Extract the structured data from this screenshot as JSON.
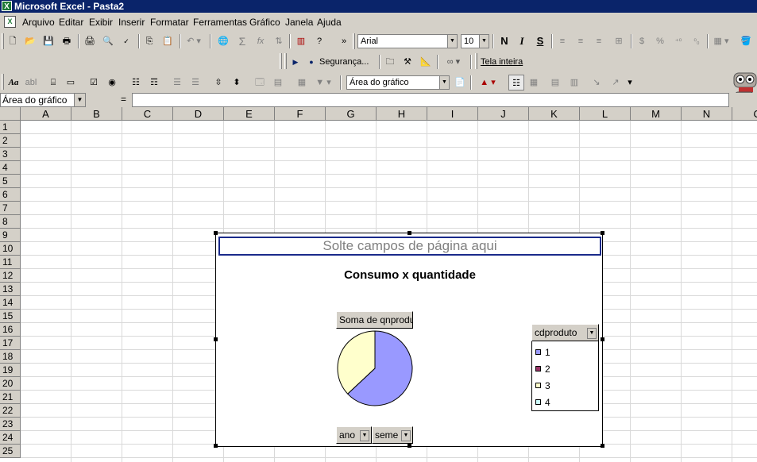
{
  "window": {
    "title": "Microsoft Excel - Pasta2"
  },
  "menu": [
    "Arquivo",
    "Editar",
    "Exibir",
    "Inserir",
    "Formatar",
    "Ferramentas",
    "Gráfico",
    "Janela",
    "Ajuda"
  ],
  "toolbar_standard": {
    "font_name": "Arial",
    "font_size": "10",
    "bold_label": "N",
    "italic_label": "I",
    "underline_label": "S"
  },
  "toolbar_security": {
    "security_label": "Segurança...",
    "fullscreen_label": "Tela inteira"
  },
  "toolbar_chart": {
    "chart_area_label": "Área do gráfico",
    "font_label": "Aa",
    "abl_label": "abl"
  },
  "formula_bar": {
    "name_box": "Área do gráfico",
    "equals": "="
  },
  "columns": [
    "A",
    "B",
    "C",
    "D",
    "E",
    "F",
    "G",
    "H",
    "I",
    "J",
    "K",
    "L",
    "M",
    "N",
    "O"
  ],
  "rows": [
    "1",
    "2",
    "3",
    "4",
    "5",
    "6",
    "7",
    "8",
    "9",
    "10",
    "11",
    "12",
    "13",
    "14",
    "15",
    "16",
    "17",
    "18",
    "19",
    "20",
    "21",
    "22",
    "23",
    "24",
    "25"
  ],
  "chart": {
    "drop_zone_text": "Solte campos de página aqui",
    "title": "Consumo x quantidade",
    "data_field_label": "Soma de qnproduto",
    "legend_field_label": "cdproduto",
    "category_fields": [
      "ano",
      "seme"
    ],
    "legend_items": [
      "1",
      "2",
      "3",
      "4"
    ],
    "colors": {
      "series1": "#9999ff",
      "series2": "#993366",
      "series3": "#ffffcc",
      "series4": "#ccffff"
    }
  },
  "chart_data": {
    "type": "pie",
    "title": "Consumo x quantidade",
    "categories": [
      "1",
      "3"
    ],
    "values": [
      63,
      37
    ]
  }
}
